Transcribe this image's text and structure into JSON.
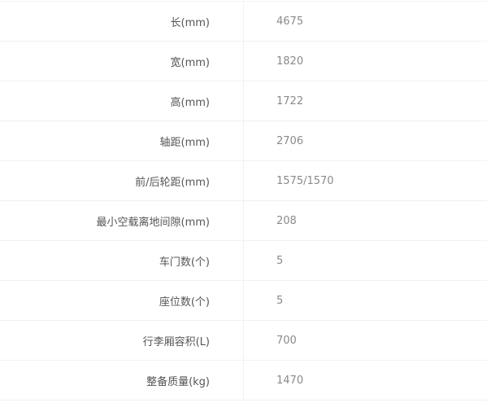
{
  "specs": [
    {
      "label": "长(mm)",
      "value": "4675"
    },
    {
      "label": "宽(mm)",
      "value": "1820"
    },
    {
      "label": "高(mm)",
      "value": "1722"
    },
    {
      "label": "轴距(mm)",
      "value": "2706"
    },
    {
      "label": "前/后轮距(mm)",
      "value": "1575/1570"
    },
    {
      "label": "最小空载离地间隙(mm)",
      "value": "208"
    },
    {
      "label": "车门数(个)",
      "value": "5"
    },
    {
      "label": "座位数(个)",
      "value": "5"
    },
    {
      "label": "行李厢容积(L)",
      "value": "700"
    },
    {
      "label": "整备质量(kg)",
      "value": "1470"
    }
  ]
}
